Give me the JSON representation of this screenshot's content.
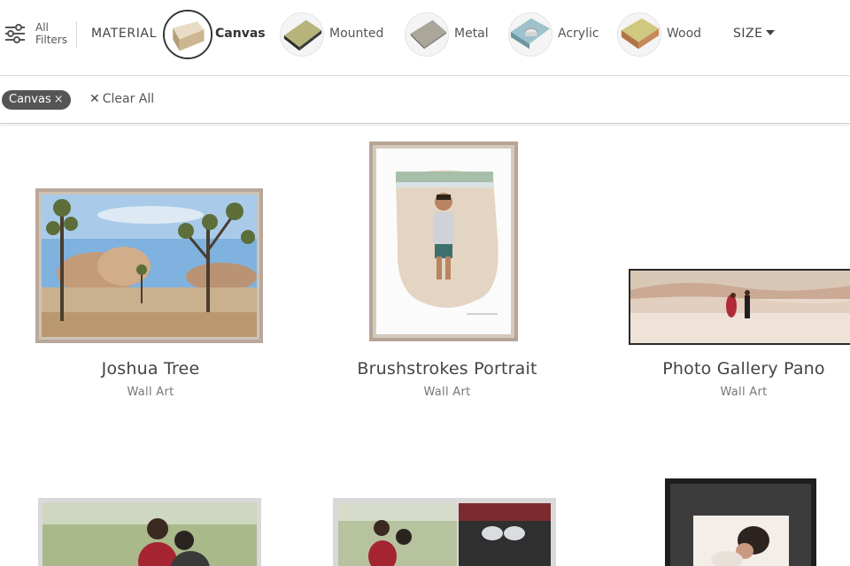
{
  "filters": {
    "all_filters_label": "All Filters",
    "material_label": "MATERIAL",
    "materials": [
      {
        "label": "Canvas",
        "selected": true,
        "icon": "canvas-swatch-icon"
      },
      {
        "label": "Mounted",
        "selected": false,
        "icon": "mounted-swatch-icon"
      },
      {
        "label": "Metal",
        "selected": false,
        "icon": "metal-swatch-icon"
      },
      {
        "label": "Acrylic",
        "selected": false,
        "icon": "acrylic-swatch-icon"
      },
      {
        "label": "Wood",
        "selected": false,
        "icon": "wood-swatch-icon"
      }
    ],
    "size_label": "SIZE"
  },
  "applied": {
    "chip_label": "Canvas",
    "chip_close_glyph": "×",
    "clear_all_glyph": "✕",
    "clear_all_label": "Clear All"
  },
  "products": [
    {
      "title": "Joshua Tree",
      "subtitle": "Wall Art"
    },
    {
      "title": "Brushstrokes Portrait",
      "subtitle": "Wall Art"
    },
    {
      "title": "Photo Gallery Pano",
      "subtitle": "Wall Art"
    },
    {
      "title": "",
      "subtitle": ""
    },
    {
      "title": "",
      "subtitle": ""
    },
    {
      "title": "",
      "subtitle": ""
    }
  ],
  "colors": {
    "chip_bg": "#555555",
    "frame_wood": "#b9a99a",
    "frame_black": "#222222"
  }
}
